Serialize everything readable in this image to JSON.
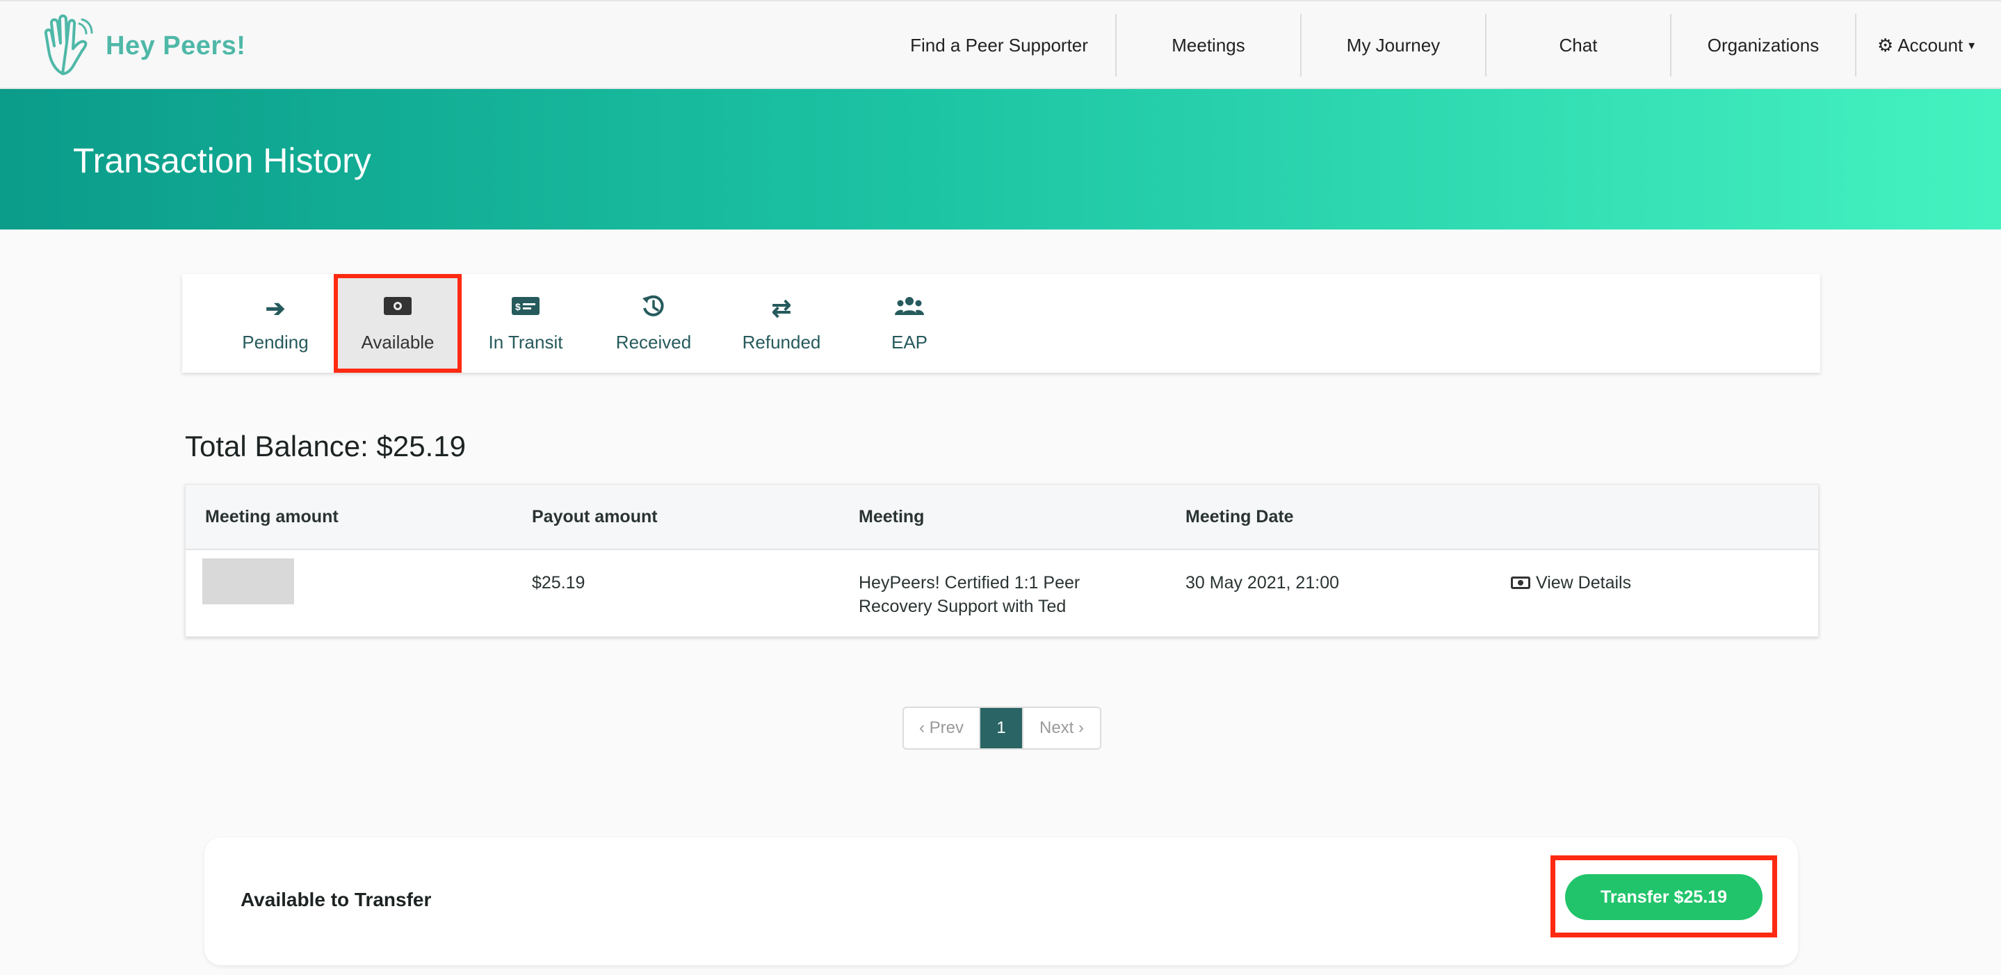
{
  "brand": {
    "name": "Hey Peers!",
    "accent": "#4fb8a8"
  },
  "nav": {
    "items": [
      "Find a Peer Supporter",
      "Meetings",
      "My Journey",
      "Chat",
      "Organizations"
    ],
    "account_label": "Account"
  },
  "hero": {
    "title": "Transaction History"
  },
  "tabs": [
    {
      "label": "Pending",
      "icon": "arrow-right-icon"
    },
    {
      "label": "Available",
      "icon": "money-bill-icon",
      "active": true
    },
    {
      "label": "In Transit",
      "icon": "money-check-icon"
    },
    {
      "label": "Received",
      "icon": "history-icon"
    },
    {
      "label": "Refunded",
      "icon": "exchange-icon"
    },
    {
      "label": "EAP",
      "icon": "users-icon"
    }
  ],
  "balance": {
    "text": "Total Balance: $25.19"
  },
  "table": {
    "headers": [
      "Meeting amount",
      "Payout amount",
      "Meeting",
      "Meeting Date"
    ],
    "rows": [
      {
        "meeting_amount": "",
        "payout_amount": "$25.19",
        "meeting_line1": "HeyPeers! Certified 1:1 Peer",
        "meeting_line2": "Recovery Support with Ted",
        "meeting_date": "30 May 2021, 21:00",
        "action": "View Details"
      }
    ]
  },
  "pagination": {
    "prev": "‹ Prev",
    "current": "1",
    "next": "Next ›"
  },
  "transfer": {
    "label": "Available to Transfer",
    "button": "Transfer $25.19",
    "button_color": "#21c46a"
  },
  "highlight_color": "#ff2a12"
}
